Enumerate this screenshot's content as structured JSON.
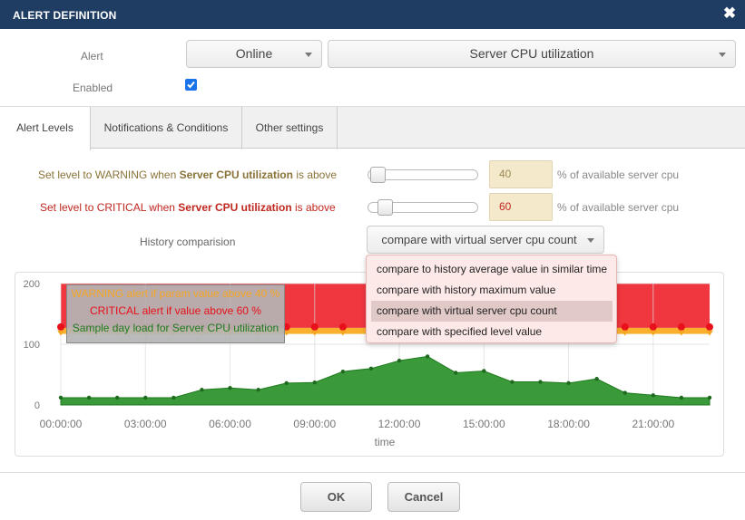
{
  "dialog": {
    "title": "ALERT DEFINITION",
    "close_icon": "close-icon"
  },
  "form": {
    "alert_label": "Alert",
    "alert_scope_value": "Online",
    "alert_metric_value": "Server CPU utilization",
    "enabled_label": "Enabled",
    "enabled_checked": true
  },
  "tabs": [
    {
      "label": "Alert Levels",
      "active": true
    },
    {
      "label": "Notifications & Conditions",
      "active": false
    },
    {
      "label": "Other settings",
      "active": false
    }
  ],
  "levels": {
    "warning": {
      "prefix": "Set level to WARNING when ",
      "metric": "Server CPU utilization",
      "suffix": " is above",
      "value": "40",
      "slider_fraction": 0.0,
      "unit": "% of available server cpu",
      "color": "#8a7338"
    },
    "critical": {
      "prefix": "Set level to CRITICAL when ",
      "metric": "Server CPU utilization",
      "suffix": " is above",
      "value": "60",
      "slider_fraction": 0.05,
      "unit": "% of available server cpu",
      "color": "#c0271f"
    },
    "history_label": "History comparision",
    "history_value": "compare with virtual server cpu count",
    "history_options": [
      "compare to history average value in similar time",
      "compare with history maximum value",
      "compare with virtual server cpu count",
      "compare with specified level value"
    ],
    "history_selected_index": 2
  },
  "chart_data": {
    "type": "area",
    "xlabel": "time",
    "ylabel": "",
    "ylim": [
      0,
      200
    ],
    "yticks": [
      "200",
      "100",
      "0"
    ],
    "xticks": [
      "00:00:00",
      "03:00:00",
      "06:00:00",
      "09:00:00",
      "12:00:00",
      "15:00:00",
      "18:00:00",
      "21:00:00"
    ],
    "legend": [
      {
        "label": "WARNING alert if param value above 40 %",
        "color": "#f5a623"
      },
      {
        "label": "CRITICAL alert if value above 60 %",
        "color": "#e8101a"
      },
      {
        "label": "Sample day load for Server CPU utilization",
        "color": "#2e8b2e"
      }
    ],
    "critical_level": 127,
    "warning_level": 117,
    "series": [
      {
        "name": "Sample day load for Server CPU utilization",
        "x": [
          0,
          1,
          2,
          3,
          4,
          5,
          6,
          7,
          8,
          9,
          10,
          11,
          12,
          13,
          14,
          15,
          16,
          17,
          18,
          19,
          20,
          21,
          22,
          23
        ],
        "values": [
          12,
          12,
          12,
          12,
          12,
          25,
          28,
          25,
          36,
          37,
          55,
          60,
          73,
          80,
          53,
          56,
          38,
          38,
          36,
          43,
          20,
          16,
          12,
          12
        ]
      }
    ]
  },
  "footer": {
    "ok_label": "OK",
    "cancel_label": "Cancel"
  }
}
